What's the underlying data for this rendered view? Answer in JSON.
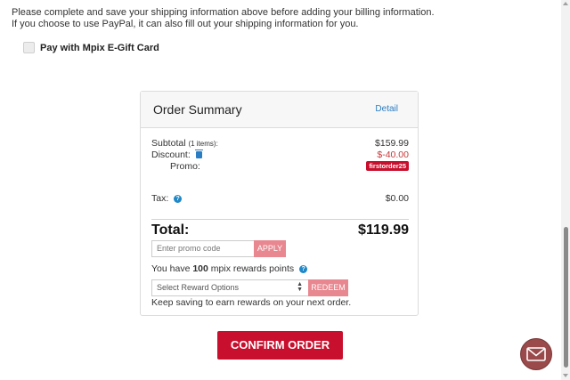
{
  "notice": {
    "line1": "Please complete and save your shipping information above before adding your billing information.",
    "line2": "If you choose to use PayPal, it can also fill out your shipping information for you."
  },
  "gift_card": {
    "label": "Pay with Mpix E-Gift Card",
    "checked": false
  },
  "summary": {
    "title": "Order Summary",
    "detail_link": "Detail",
    "subtotal_label": "Subtotal",
    "subtotal_items": "(1 items):",
    "subtotal_value": "$159.99",
    "discount_label": "Discount:",
    "discount_value": "$-40.00",
    "promo_label": "Promo:",
    "promo_code": "firstorder25",
    "tax_label": "Tax:",
    "tax_value": "$0.00",
    "total_label": "Total:",
    "total_value": "$119.99"
  },
  "promo_input": {
    "placeholder": "Enter promo code",
    "apply_label": "APPLY"
  },
  "rewards": {
    "prefix": "You have",
    "points": "100",
    "suffix": "mpix rewards points",
    "select_value": "Select Reward Options",
    "redeem_label": "REDEEM",
    "keep_saving": "Keep saving to earn rewards on your next order."
  },
  "confirm_label": "CONFIRM ORDER",
  "colors": {
    "brand": "#c8102e",
    "button_disabled": "#e8878f",
    "link": "#2a7dc3",
    "chat": "#9a4a4a"
  },
  "icons": {
    "trash": "trash-icon",
    "help": "question-circle-icon",
    "chat": "envelope-icon"
  }
}
